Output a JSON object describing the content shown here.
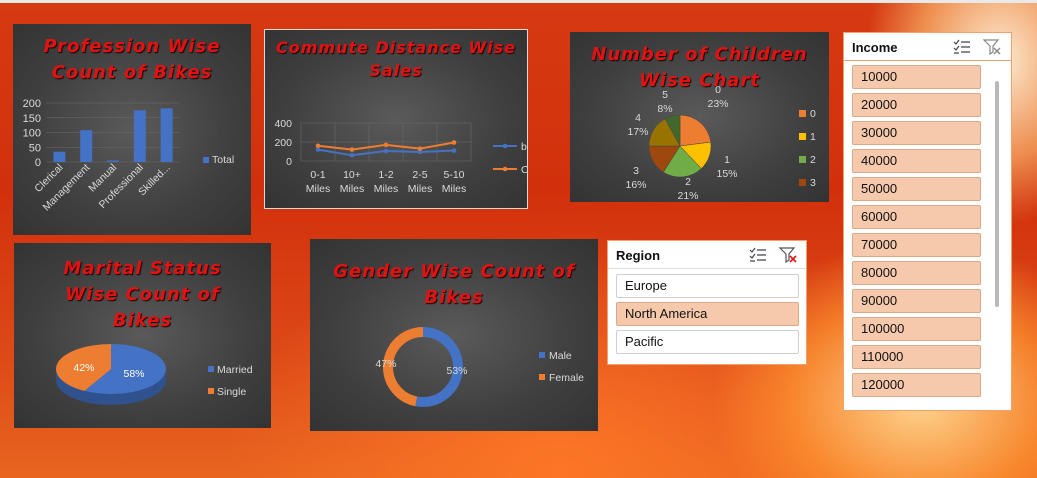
{
  "colors": {
    "background": "#d2300c",
    "title_red": "#e01313",
    "blue": "#4472c4",
    "orange": "#ed7d31",
    "slicer_selected": "#f6c9ac"
  },
  "profession_chart": {
    "title_line1": "Profession Wise",
    "title_line2": "Count of Bikes",
    "chart_data": {
      "type": "bar",
      "categories": [
        "Clerical",
        "Management",
        "Manual",
        "Professional",
        "Skilled..."
      ],
      "series": [
        {
          "name": "Total",
          "values": [
            35,
            108,
            5,
            175,
            182
          ]
        }
      ],
      "yticks": [
        "200",
        "150",
        "100",
        "50",
        "0"
      ],
      "ylim": [
        0,
        200
      ],
      "legend": "right"
    }
  },
  "commute_chart": {
    "title_line1": "Commute Distance Wise",
    "title_line2": "Sales",
    "chart_data": {
      "type": "line",
      "categories": [
        "0-1 Miles",
        "10+ Miles",
        "1-2 Miles",
        "2-5 Miles",
        "5-10 Miles"
      ],
      "series": [
        {
          "name": "bike",
          "values": [
            120,
            60,
            105,
            95,
            110
          ]
        },
        {
          "name": "Car",
          "values": [
            160,
            120,
            170,
            130,
            195
          ]
        }
      ],
      "yticks": [
        "400",
        "200",
        "0"
      ],
      "ylim": [
        0,
        400
      ],
      "legend": "right"
    }
  },
  "children_chart": {
    "title_line1": "Number of Children",
    "title_line2": "Wise Chart",
    "chart_data": {
      "type": "pie",
      "legend": "right",
      "slices": [
        {
          "label": "0",
          "pct": "23%",
          "value": 23,
          "color": "#ed7d31"
        },
        {
          "label": "1",
          "pct": "15%",
          "value": 15,
          "color": "#ffc000"
        },
        {
          "label": "2",
          "pct": "21%",
          "value": 21,
          "color": "#70ad47"
        },
        {
          "label": "3",
          "pct": "16%",
          "value": 16,
          "color": "#9e480e"
        },
        {
          "label": "4",
          "pct": "17%",
          "value": 17,
          "color": "#997300"
        },
        {
          "label": "5",
          "pct": "8%",
          "value": 8,
          "color": "#43682b"
        }
      ]
    }
  },
  "marital_chart": {
    "title_line1": "Marital Status",
    "title_line2": "Wise Count of",
    "title_line3": "Bikes",
    "chart_data": {
      "type": "pie",
      "legend": "right",
      "slices": [
        {
          "label": "Married",
          "pct": "58%",
          "value": 58
        },
        {
          "label": "Single",
          "pct": "42%",
          "value": 42
        }
      ]
    }
  },
  "gender_chart": {
    "title_line1": "Gender Wise Count of",
    "title_line2": "Bikes",
    "chart_data": {
      "type": "pie",
      "legend": "right",
      "slices": [
        {
          "label": "Male",
          "pct": "53%",
          "value": 53
        },
        {
          "label": "Female",
          "pct": "47%",
          "value": 47
        }
      ]
    }
  },
  "region_slicer": {
    "title": "Region",
    "items": [
      {
        "label": "Europe",
        "selected": false
      },
      {
        "label": "North America",
        "selected": true
      },
      {
        "label": "Pacific",
        "selected": false
      }
    ]
  },
  "income_slicer": {
    "title": "Income",
    "items": [
      "10000",
      "20000",
      "30000",
      "40000",
      "50000",
      "60000",
      "70000",
      "80000",
      "90000",
      "100000",
      "110000",
      "120000"
    ]
  },
  "icons": {
    "multiselect": "multi-select-icon",
    "clear_filter": "clear-filter-icon"
  }
}
